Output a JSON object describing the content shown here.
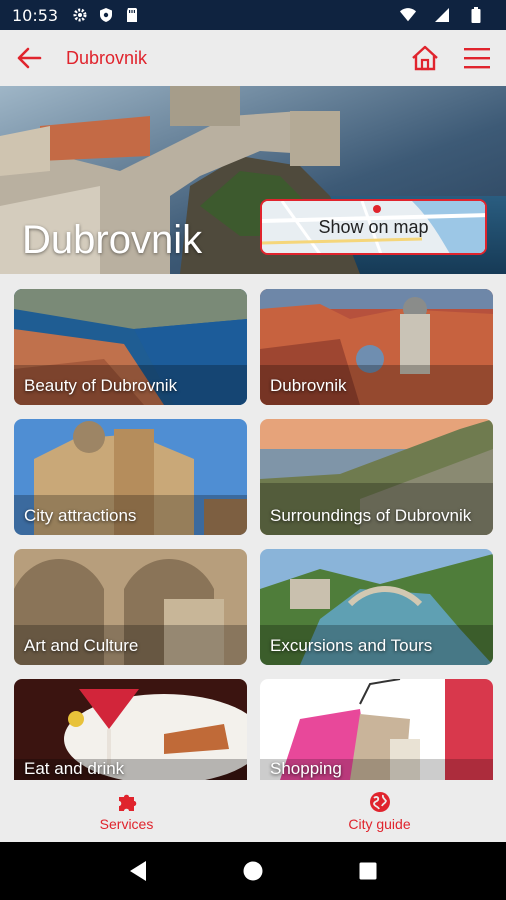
{
  "status_bar": {
    "time": "10:53",
    "icons": [
      "gear-icon",
      "shield-icon",
      "sd-card-icon"
    ],
    "right_icons": [
      "wifi-icon",
      "cell-signal-icon",
      "battery-icon"
    ]
  },
  "app_bar": {
    "title": "Dubrovnik",
    "back_icon": "arrow-left-icon",
    "home_icon": "home-icon",
    "menu_icon": "hamburger-menu-icon"
  },
  "hero": {
    "title": "Dubrovnik",
    "map_button_label": "Show on map"
  },
  "categories": [
    {
      "label": "Beauty of Dubrovnik"
    },
    {
      "label": "Dubrovnik"
    },
    {
      "label": "City attractions"
    },
    {
      "label": "Surroundings of Dubrovnik"
    },
    {
      "label": "Art and Culture"
    },
    {
      "label": "Excursions and Tours"
    },
    {
      "label": "Eat and drink"
    },
    {
      "label": "Shopping"
    }
  ],
  "bottom_nav": {
    "services_label": "Services",
    "city_guide_label": "City guide"
  },
  "colors": {
    "accent": "#e0242d",
    "status_bar": "#0f2340",
    "background": "#ececec"
  }
}
